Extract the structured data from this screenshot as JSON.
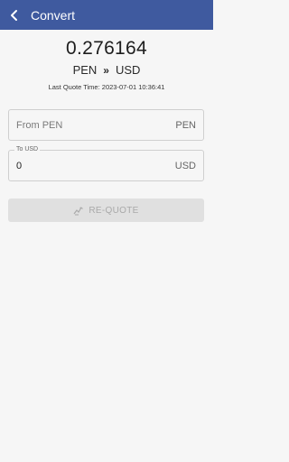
{
  "header": {
    "title": "Convert",
    "back_icon": "chevron-left-icon"
  },
  "rate": {
    "value": "0.276164",
    "from": "PEN",
    "to": "USD",
    "separator": "»"
  },
  "quote": {
    "time_text": "Last Quote Time: 2023-07-01 10:36:41"
  },
  "from_field": {
    "placeholder": "From PEN",
    "value": "",
    "currency": "PEN"
  },
  "to_field": {
    "label": "To USD",
    "value": "0",
    "currency": "USD"
  },
  "requote_button": {
    "label": "RE-QUOTE",
    "icon": "refresh-icon",
    "enabled": false
  },
  "colors": {
    "appbar": "#3f5a9f",
    "background": "#f6f6f6",
    "button_disabled": "#e0e0e0"
  }
}
